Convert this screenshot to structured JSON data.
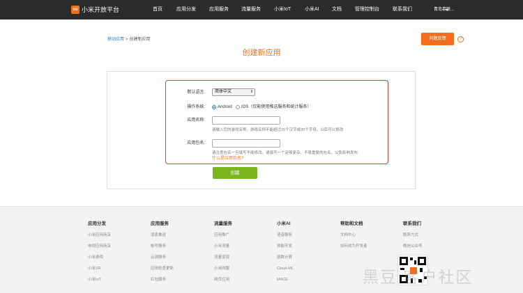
{
  "header": {
    "logo_text": "mi",
    "brand": "小米开放平台",
    "nav": [
      "首页",
      "应用分发",
      "应用服务",
      "流量服务",
      "小米IoT",
      "小米AI",
      "文档",
      "管理控制台",
      "联系我们"
    ],
    "user": "青岛慕联..."
  },
  "breadcrumb": {
    "parent": "移动应用",
    "separator": ">",
    "current": "创建新应用"
  },
  "feedback_button": "问题反馈",
  "help_icon": "?",
  "page_title": "创建新应用",
  "form": {
    "language_label": "默认语言:",
    "language_value": "简体中文",
    "os_label": "操作系统:",
    "os_options": [
      "Android",
      "IOS（仅能使用推送服务和统计服务）"
    ],
    "os_selected": "Android",
    "app_name_label": "应用名称:",
    "app_name_value": "",
    "app_name_hint": "请输入您的游戏名称。游戏名称不能超过15个汉字或30个字母。以后可以修改",
    "package_label": "应用包名:",
    "package_value": "",
    "package_hint": "请注意包名一旦填写不能修改。请填写一个足够复杂、不易重复的包名，以免影响发布",
    "package_link": "什么是应用包名?",
    "submit": "创建"
  },
  "footer": {
    "columns": [
      {
        "title": "应用分发",
        "links": [
          "小米应用商店",
          "电视应用商店",
          "小米游戏",
          "小米VR",
          "小米IoT"
        ]
      },
      {
        "title": "应用服务",
        "links": [
          "消息推送",
          "帐号服务",
          "云测服务",
          "应用检查更新",
          "红包服务"
        ]
      },
      {
        "title": "流量服务",
        "links": [
          "应用推广",
          "小米流量",
          "流量变现",
          "小米网盟",
          "网页应用"
        ]
      },
      {
        "title": "小米AI",
        "links": [
          "语音服务",
          "技能开发",
          "函数计算",
          "Cloud-ML",
          "MACE"
        ]
      },
      {
        "title": "帮助和文档",
        "links": [
          "文档中心",
          "如何成为开发者"
        ]
      },
      {
        "title": "联系我们",
        "links": [
          "联系方式",
          "微信公众号"
        ]
      }
    ]
  },
  "watermark": "黑豆    客户社区",
  "colors": {
    "accent": "#f36e1b",
    "nav_bg": "#2b2b2b",
    "button_green": "#7ab51d",
    "highlight_red": "#e43b26",
    "link_blue": "#1e78c2"
  }
}
